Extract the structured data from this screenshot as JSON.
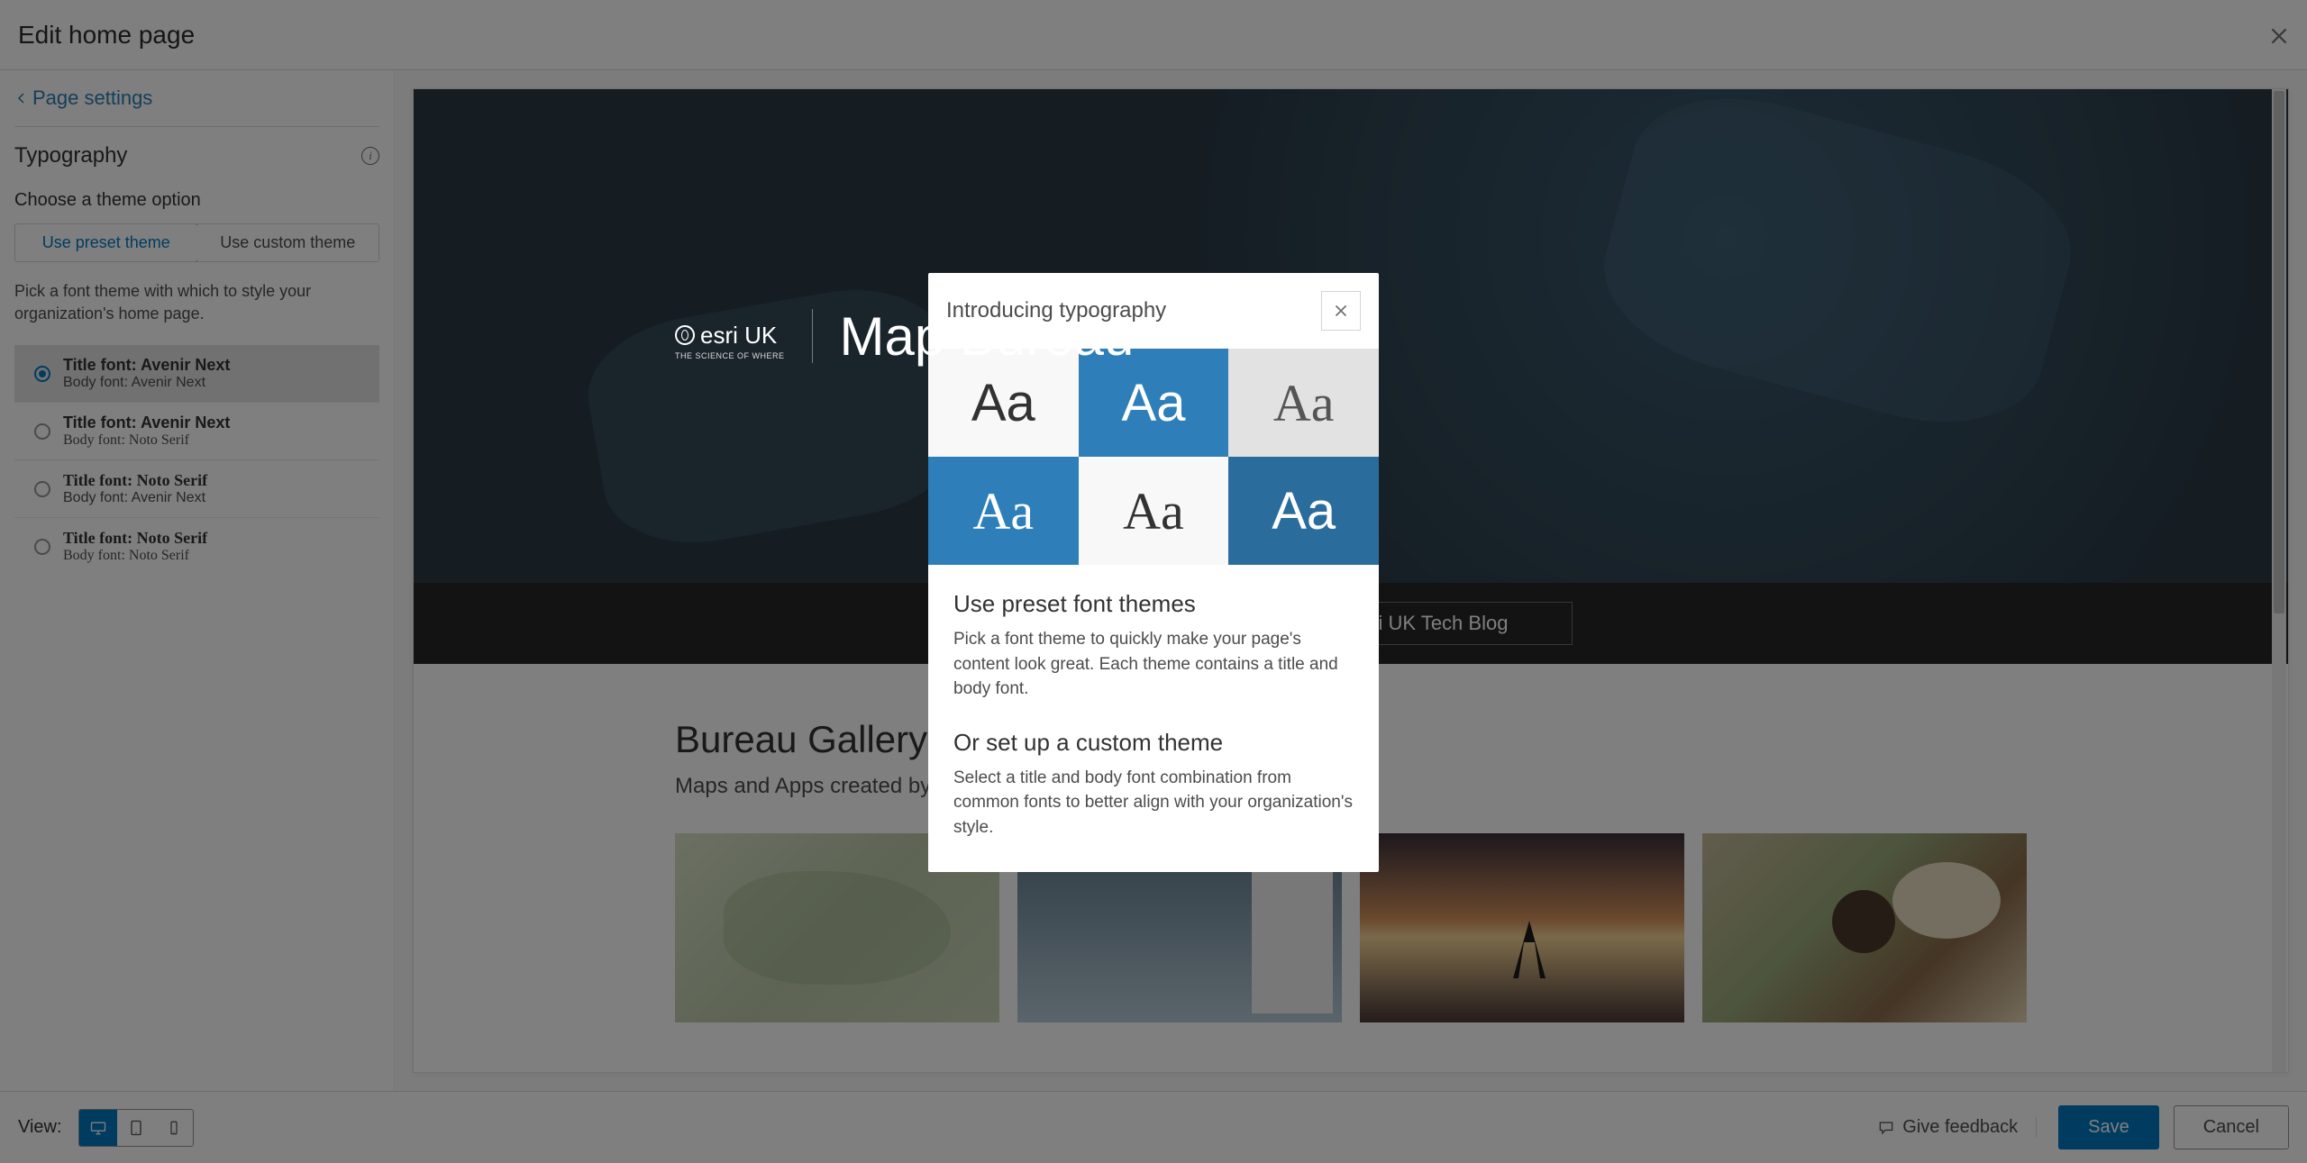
{
  "header": {
    "title": "Edit home page"
  },
  "sidebar": {
    "breadcrumb": "Page settings",
    "section_title": "Typography",
    "choose_label": "Choose a theme option",
    "preset_btn": "Use preset theme",
    "custom_btn": "Use custom theme",
    "description": "Pick a font theme with which to style your organization's home page.",
    "themes": [
      {
        "title": "Title font: Avenir Next",
        "body": "Body font: Avenir Next",
        "selected": true,
        "serif_title": false,
        "serif_body": false
      },
      {
        "title": "Title font: Avenir Next",
        "body": "Body font: Noto Serif",
        "selected": false,
        "serif_title": false,
        "serif_body": true
      },
      {
        "title": "Title font: Noto Serif",
        "body": "Body font: Avenir Next",
        "selected": false,
        "serif_title": true,
        "serif_body": false
      },
      {
        "title": "Title font: Noto Serif",
        "body": "Body font: Noto Serif",
        "selected": false,
        "serif_title": true,
        "serif_body": true
      }
    ]
  },
  "preview": {
    "logo_text": "esri UK",
    "logo_sub": "THE SCIENCE OF WHERE",
    "hero_title": "Map Bureau",
    "buttons": [
      "Esri UK Tech Blog"
    ],
    "gallery_title": "Bureau Gallery",
    "gallery_sub": "Maps and Apps created by the Map Bureau"
  },
  "modal": {
    "title": "Introducing typography",
    "swatch_text": "Aa",
    "h1": "Use preset font themes",
    "p1": "Pick a font theme to quickly make your page's content look great. Each theme contains a title and body font.",
    "h2": "Or set up a custom theme",
    "p2": "Select a title and body font combination from common fonts to better align with your organization's style."
  },
  "footer": {
    "view_label": "View:",
    "feedback": "Give feedback",
    "save": "Save",
    "cancel": "Cancel"
  }
}
